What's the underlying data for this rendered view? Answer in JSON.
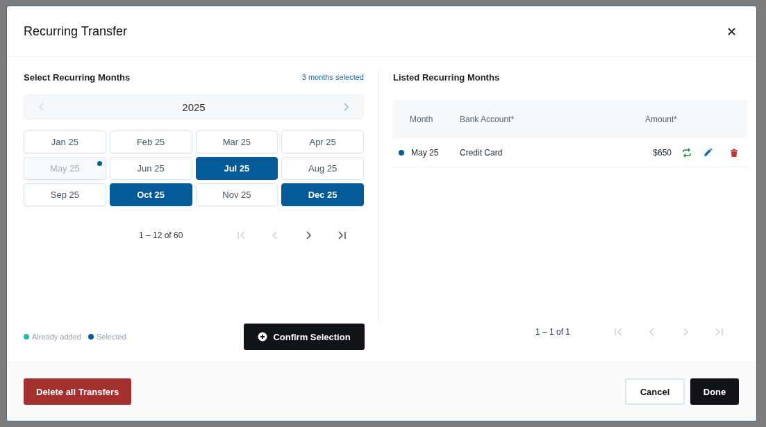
{
  "dialog": {
    "title": "Recurring Transfer",
    "close_label": "✕"
  },
  "picker": {
    "title": "Select Recurring Months",
    "selected_count": "3 months selected",
    "year": {
      "label": "2025",
      "prev_disabled": true,
      "next_disabled": false
    },
    "months": [
      {
        "label": "Jan 25",
        "selected": false,
        "added": false
      },
      {
        "label": "Feb 25",
        "selected": false,
        "added": false
      },
      {
        "label": "Mar 25",
        "selected": false,
        "added": false
      },
      {
        "label": "Apr 25",
        "selected": false,
        "added": false
      },
      {
        "label": "May 25",
        "selected": false,
        "added": true
      },
      {
        "label": "Jun 25",
        "selected": false,
        "added": false
      },
      {
        "label": "Jul 25",
        "selected": true,
        "added": false
      },
      {
        "label": "Aug 25",
        "selected": false,
        "added": false
      },
      {
        "label": "Sep 25",
        "selected": false,
        "added": false
      },
      {
        "label": "Oct 25",
        "selected": true,
        "added": false
      },
      {
        "label": "Nov 25",
        "selected": false,
        "added": false
      },
      {
        "label": "Dec 25",
        "selected": true,
        "added": false
      }
    ],
    "pager": {
      "range": "1 – 12 of 60",
      "buttons": [
        {
          "kind": "first",
          "disabled": true
        },
        {
          "kind": "prev",
          "disabled": true
        },
        {
          "kind": "next",
          "disabled": false
        },
        {
          "kind": "last",
          "disabled": false
        }
      ]
    },
    "legend": [
      {
        "label": "Already added",
        "color": "#2bb5a8"
      },
      {
        "label": "Selected",
        "color": "#0b5c96"
      }
    ],
    "confirm_button": "Confirm Selection"
  },
  "listing": {
    "title": "Listed Recurring Months",
    "columns": [
      "Month",
      "Bank Account*",
      "Amount*"
    ],
    "rows": [
      {
        "month": "May 25",
        "account": "Credit Card",
        "amount": "$650",
        "color": "#0b5c96"
      }
    ],
    "pager": {
      "range": "1 – 1 of 1",
      "buttons": [
        {
          "kind": "first",
          "disabled": true
        },
        {
          "kind": "prev",
          "disabled": true
        },
        {
          "kind": "next",
          "disabled": true
        },
        {
          "kind": "last",
          "disabled": true
        }
      ]
    }
  },
  "footer": {
    "delete_button": "Delete all Transfers",
    "cancel_button": "Cancel",
    "done_button": "Done"
  }
}
